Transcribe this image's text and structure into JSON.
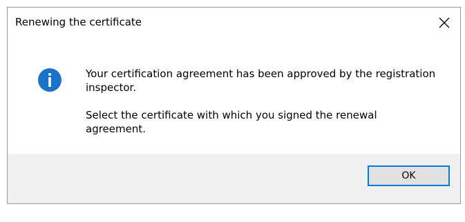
{
  "window": {
    "title": "Renewing the certificate",
    "close_icon": "close-icon"
  },
  "message": {
    "icon": "info-icon",
    "icon_color": "#1a73c9",
    "line1": "Your certification agreement has been approved by the registration inspector.",
    "line2": "Select the certificate with which you signed the renewal agreement."
  },
  "footer": {
    "ok_label": "OK",
    "accent_color": "#0078d7"
  }
}
